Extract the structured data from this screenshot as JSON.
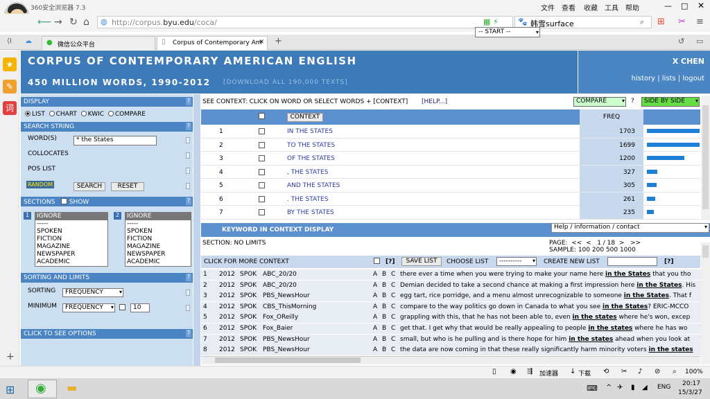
{
  "browser": {
    "title": "360安全浏览器 7.3",
    "menus": [
      "文件",
      "查看",
      "收藏",
      "工具",
      "帮助"
    ],
    "url_prefix": "http://corpus.",
    "url_domain": "byu.edu",
    "url_suffix": "/coca/",
    "search_text": "韩雪surface",
    "tabs": [
      {
        "label": "微信公众平台",
        "active": false
      },
      {
        "label": "Corpus of Contemporary Am",
        "active": true
      }
    ]
  },
  "banner": {
    "title": "CORPUS OF CONTEMPORARY AMERICAN ENGLISH",
    "subtitle": "450 MILLION WORDS, 1990-2012",
    "download": "[DOWNLOAD ALL 190,000 TEXTS]",
    "start_label": "-- START --",
    "help_q": "?"
  },
  "user": {
    "name": "X CHEN",
    "links": "history | lists | logout"
  },
  "left": {
    "display_head": "DISPLAY",
    "display_options": [
      "LIST",
      "CHART",
      "KWIC",
      "COMPARE"
    ],
    "search_head": "SEARCH STRING",
    "words_label": "WORD(S)",
    "words_value": "* the States",
    "collocates_label": "COLLOCATES",
    "pos_label": "POS LIST",
    "random_label": "RANDOM",
    "search_button": "SEARCH",
    "reset_button": "RESET",
    "sections_head": "SECTIONS",
    "show_label": "SHOW",
    "sections_list": [
      "IGNORE",
      "-----",
      "SPOKEN",
      "FICTION",
      "MAGAZINE",
      "NEWSPAPER",
      "ACADEMIC"
    ],
    "list1_num": "1",
    "list2_num": "2",
    "sort_head": "SORTING AND LIMITS",
    "sorting_label": "SORTING",
    "sorting_value": "FREQUENCY",
    "minimum_label": "MINIMUM",
    "minimum_value": "FREQUENCY",
    "minimum_num": "10",
    "options_head": "CLICK TO SEE OPTIONS"
  },
  "context_bar": {
    "text": "SEE CONTEXT: CLICK ON WORD OR SELECT WORDS + [CONTEXT]",
    "help": "[HELP...]",
    "compare": "COMPARE",
    "q": "?",
    "side": "SIDE BY SIDE"
  },
  "freq_table": {
    "context_button": "CONTEXT",
    "freq_header": "FREQ",
    "rows": [
      {
        "n": "1",
        "phrase": "IN THE STATES",
        "freq": 1703
      },
      {
        "n": "2",
        "phrase": "TO THE STATES",
        "freq": 1699
      },
      {
        "n": "3",
        "phrase": "OF THE STATES",
        "freq": 1200
      },
      {
        "n": "4",
        "phrase": ", THE STATES",
        "freq": 327
      },
      {
        "n": "5",
        "phrase": "AND THE STATES",
        "freq": 305
      },
      {
        "n": "6",
        "phrase": ". THE STATES",
        "freq": 261
      },
      {
        "n": "7",
        "phrase": "BY THE STATES",
        "freq": 235
      }
    ]
  },
  "kwic": {
    "title": "KEYWORD IN CONTEXT DISPLAY",
    "help_select": "Help / information / contact",
    "section": "SECTION: NO LIMITS",
    "page_label": "PAGE:  <<  <   1 / 18  >   >>",
    "sample_label": "SAMPLE: 100  200  500  1000",
    "more_context": "CLICK FOR MORE CONTEXT",
    "q1": "[?]",
    "save_list": "SAVE LIST",
    "choose_list": "CHOOSE LIST",
    "choose_value": "----------",
    "create_list": "CREATE NEW LIST",
    "q2": "[?]",
    "rows": [
      {
        "n": "1",
        "year": "2012",
        "genre": "SPOK",
        "source": "ABC_20/20",
        "pre": "there ever a time when you were trying to make your name here ",
        "kw": "in the States",
        "post": " that you tho"
      },
      {
        "n": "2",
        "year": "2012",
        "genre": "SPOK",
        "source": "ABC_20/20",
        "pre": "Demian decided to take a second chance at making a first impression here ",
        "kw": "in the States",
        "post": ". His"
      },
      {
        "n": "3",
        "year": "2012",
        "genre": "SPOK",
        "source": "PBS_NewsHour",
        "pre": "egg tart, rice porridge, and a menu almost unrecognizable to someone ",
        "kw": "in the States",
        "post": ". That f"
      },
      {
        "n": "4",
        "year": "2012",
        "genre": "SPOK",
        "source": "CBS_ThisMorning",
        "pre": "compare to the way politics go down in Canada to what you see ",
        "kw": "in the States",
        "post": "? ERIC-MCCO"
      },
      {
        "n": "5",
        "year": "2012",
        "genre": "SPOK",
        "source": "Fox_OReilly",
        "pre": "grappling with this, that he has not been able to, even ",
        "kw": "in the states",
        "post": " where he's won, excep"
      },
      {
        "n": "6",
        "year": "2012",
        "genre": "SPOK",
        "source": "Fox_Baier",
        "pre": "get that. I get why that would be really appealing to people ",
        "kw": "in the states",
        "post": " where he has wo"
      },
      {
        "n": "7",
        "year": "2012",
        "genre": "SPOK",
        "source": "PBS_NewsHour",
        "pre": "small, but who is he pulling and is there hope for him ",
        "kw": "in the states",
        "post": " ahead when you look at"
      },
      {
        "n": "8",
        "year": "2012",
        "genre": "SPOK",
        "source": "PBS_NewsHour",
        "pre": "the data are now coming in that these really significantly harm minority voters ",
        "kw": "in the states",
        "post": ""
      }
    ]
  },
  "statusbar": {
    "accel": "加速器",
    "download": "下载",
    "zoom": "100%"
  },
  "taskbar": {
    "lang": "ENG",
    "time": "20:17",
    "date": "15/3/27"
  }
}
